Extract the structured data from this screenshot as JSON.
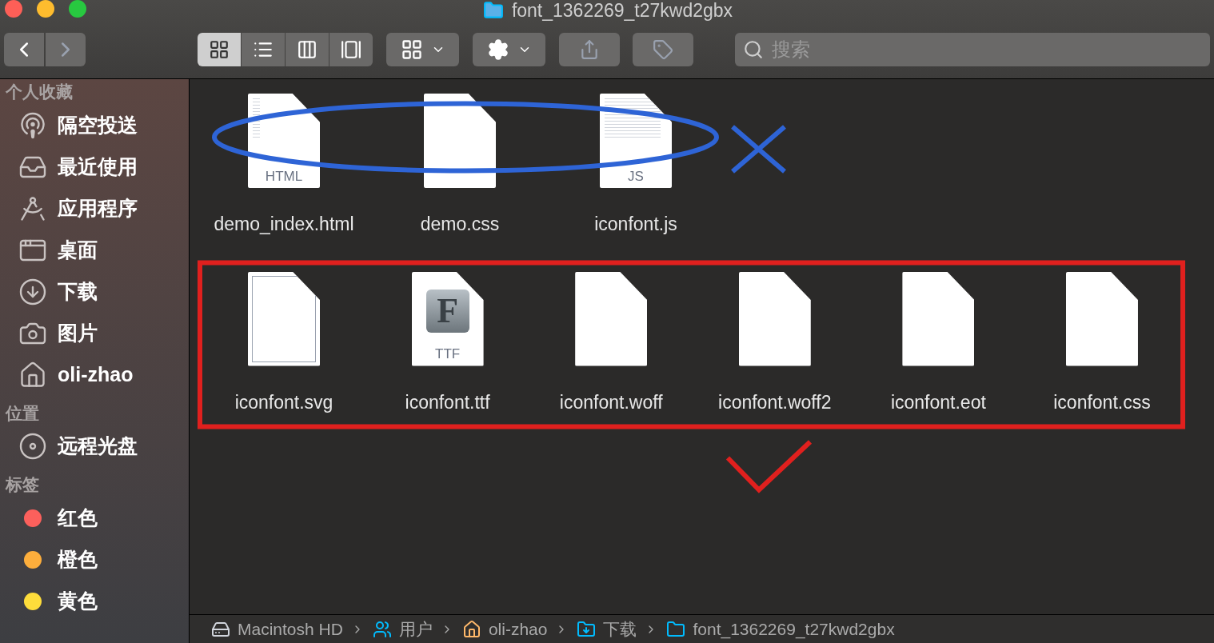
{
  "window": {
    "title": "font_1362269_t27kwd2gbx"
  },
  "toolbar": {
    "back": {
      "disabled": false
    },
    "forward": {
      "disabled": true
    },
    "view_modes": [
      {
        "kind": "icons",
        "selected": true
      },
      {
        "kind": "list",
        "selected": false
      },
      {
        "kind": "columns",
        "selected": false
      },
      {
        "kind": "gallery",
        "selected": false
      }
    ],
    "search": {
      "placeholder": "搜索"
    }
  },
  "sidebar": {
    "sections": [
      {
        "title": "个人收藏",
        "items": [
          {
            "kind": "airdrop",
            "label": "隔空投送"
          },
          {
            "kind": "recent",
            "label": "最近使用"
          },
          {
            "kind": "apps",
            "label": "应用程序"
          },
          {
            "kind": "desktop",
            "label": "桌面"
          },
          {
            "kind": "downloads",
            "label": "下载"
          },
          {
            "kind": "pictures",
            "label": "图片"
          },
          {
            "kind": "home",
            "label": "oli-zhao"
          }
        ]
      },
      {
        "title": "位置",
        "items": [
          {
            "kind": "disc",
            "label": "远程光盘"
          }
        ]
      },
      {
        "title": "标签",
        "items": [
          {
            "kind": "tag",
            "label": "红色",
            "color": "#fc605c"
          },
          {
            "kind": "tag",
            "label": "橙色",
            "color": "#fdae3c"
          },
          {
            "kind": "tag",
            "label": "黄色",
            "color": "#fedd3b"
          }
        ]
      }
    ]
  },
  "files_row_1": [
    {
      "name": "demo_index.html",
      "kind": "html",
      "badge": "HTML"
    },
    {
      "name": "demo.css",
      "kind": "blank"
    },
    {
      "name": "iconfont.js",
      "kind": "text",
      "badge": "JS"
    }
  ],
  "files_row_2": [
    {
      "name": "iconfont.svg",
      "kind": "svg"
    },
    {
      "name": "iconfont.ttf",
      "kind": "font",
      "badge": "TTF",
      "emblem": "F"
    },
    {
      "name": "iconfont.woff",
      "kind": "blank"
    },
    {
      "name": "iconfont.woff2",
      "kind": "blank"
    },
    {
      "name": "iconfont.eot",
      "kind": "blank"
    },
    {
      "name": "iconfont.css",
      "kind": "blank"
    }
  ],
  "path_bar": [
    {
      "kind": "disk",
      "label": "Macintosh HD"
    },
    {
      "kind": "users",
      "label": "用户"
    },
    {
      "kind": "home",
      "label": "oli-zhao"
    },
    {
      "kind": "downloads",
      "label": "下载"
    },
    {
      "kind": "folder",
      "label": "font_1362269_t27kwd2gbx"
    }
  ]
}
